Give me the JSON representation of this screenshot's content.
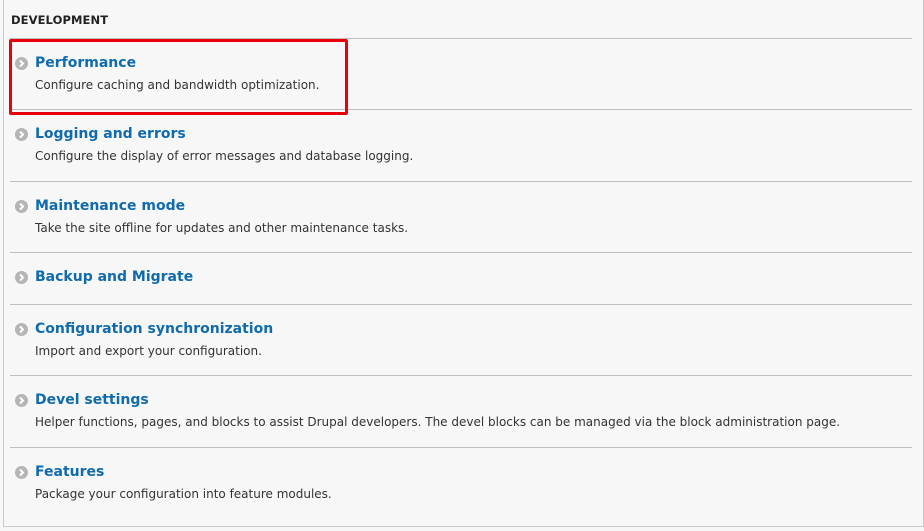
{
  "section": {
    "title": "DEVELOPMENT"
  },
  "items": [
    {
      "title": "Performance",
      "description": "Configure caching and bandwidth optimization.",
      "icon": "chevron-circle-right-icon",
      "highlighted": true
    },
    {
      "title": "Logging and errors",
      "description": "Configure the display of error messages and database logging.",
      "icon": "chevron-circle-right-icon"
    },
    {
      "title": "Maintenance mode",
      "description": "Take the site offline for updates and other maintenance tasks.",
      "icon": "chevron-circle-right-icon"
    },
    {
      "title": "Backup and Migrate",
      "description": "",
      "icon": "chevron-circle-right-icon"
    },
    {
      "title": "Configuration synchronization",
      "description": "Import and export your configuration.",
      "icon": "chevron-circle-right-icon"
    },
    {
      "title": "Devel settings",
      "description": "Helper functions, pages, and blocks to assist Drupal developers. The devel blocks can be managed via the block administration page.",
      "icon": "chevron-circle-right-icon"
    },
    {
      "title": "Features",
      "description": "Package your configuration into feature modules.",
      "icon": "chevron-circle-right-icon"
    }
  ],
  "colors": {
    "link": "#0f6bad",
    "highlight_box": "#e8000b",
    "icon": "#b5b5b5",
    "background": "#f7f7f7"
  }
}
